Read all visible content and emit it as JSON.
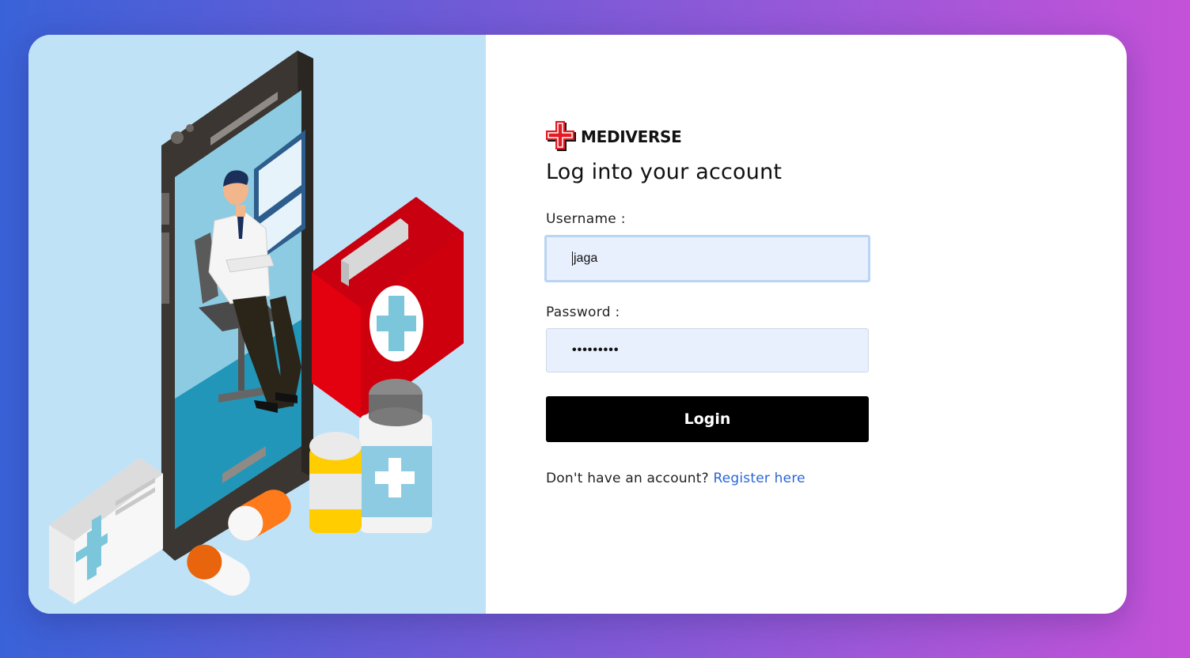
{
  "brand": {
    "name": "MEDIVERSE",
    "icon": "medical-cross-icon",
    "color": "#e31b23"
  },
  "form": {
    "heading": "Log into your account",
    "username_label": "Username :",
    "username_value": "jaga",
    "password_label": "Password :",
    "password_value": "•••••••••",
    "login_label": "Login",
    "register_prompt": "Don't have an account?",
    "register_link": "Register here"
  },
  "illustration": {
    "description_icon": "doctor-smartphone-illustration"
  },
  "colors": {
    "accent": "#2a66d8",
    "button": "#000000",
    "input_bg": "#e8f0fe",
    "illustration_bg": "#bfe2f7"
  }
}
